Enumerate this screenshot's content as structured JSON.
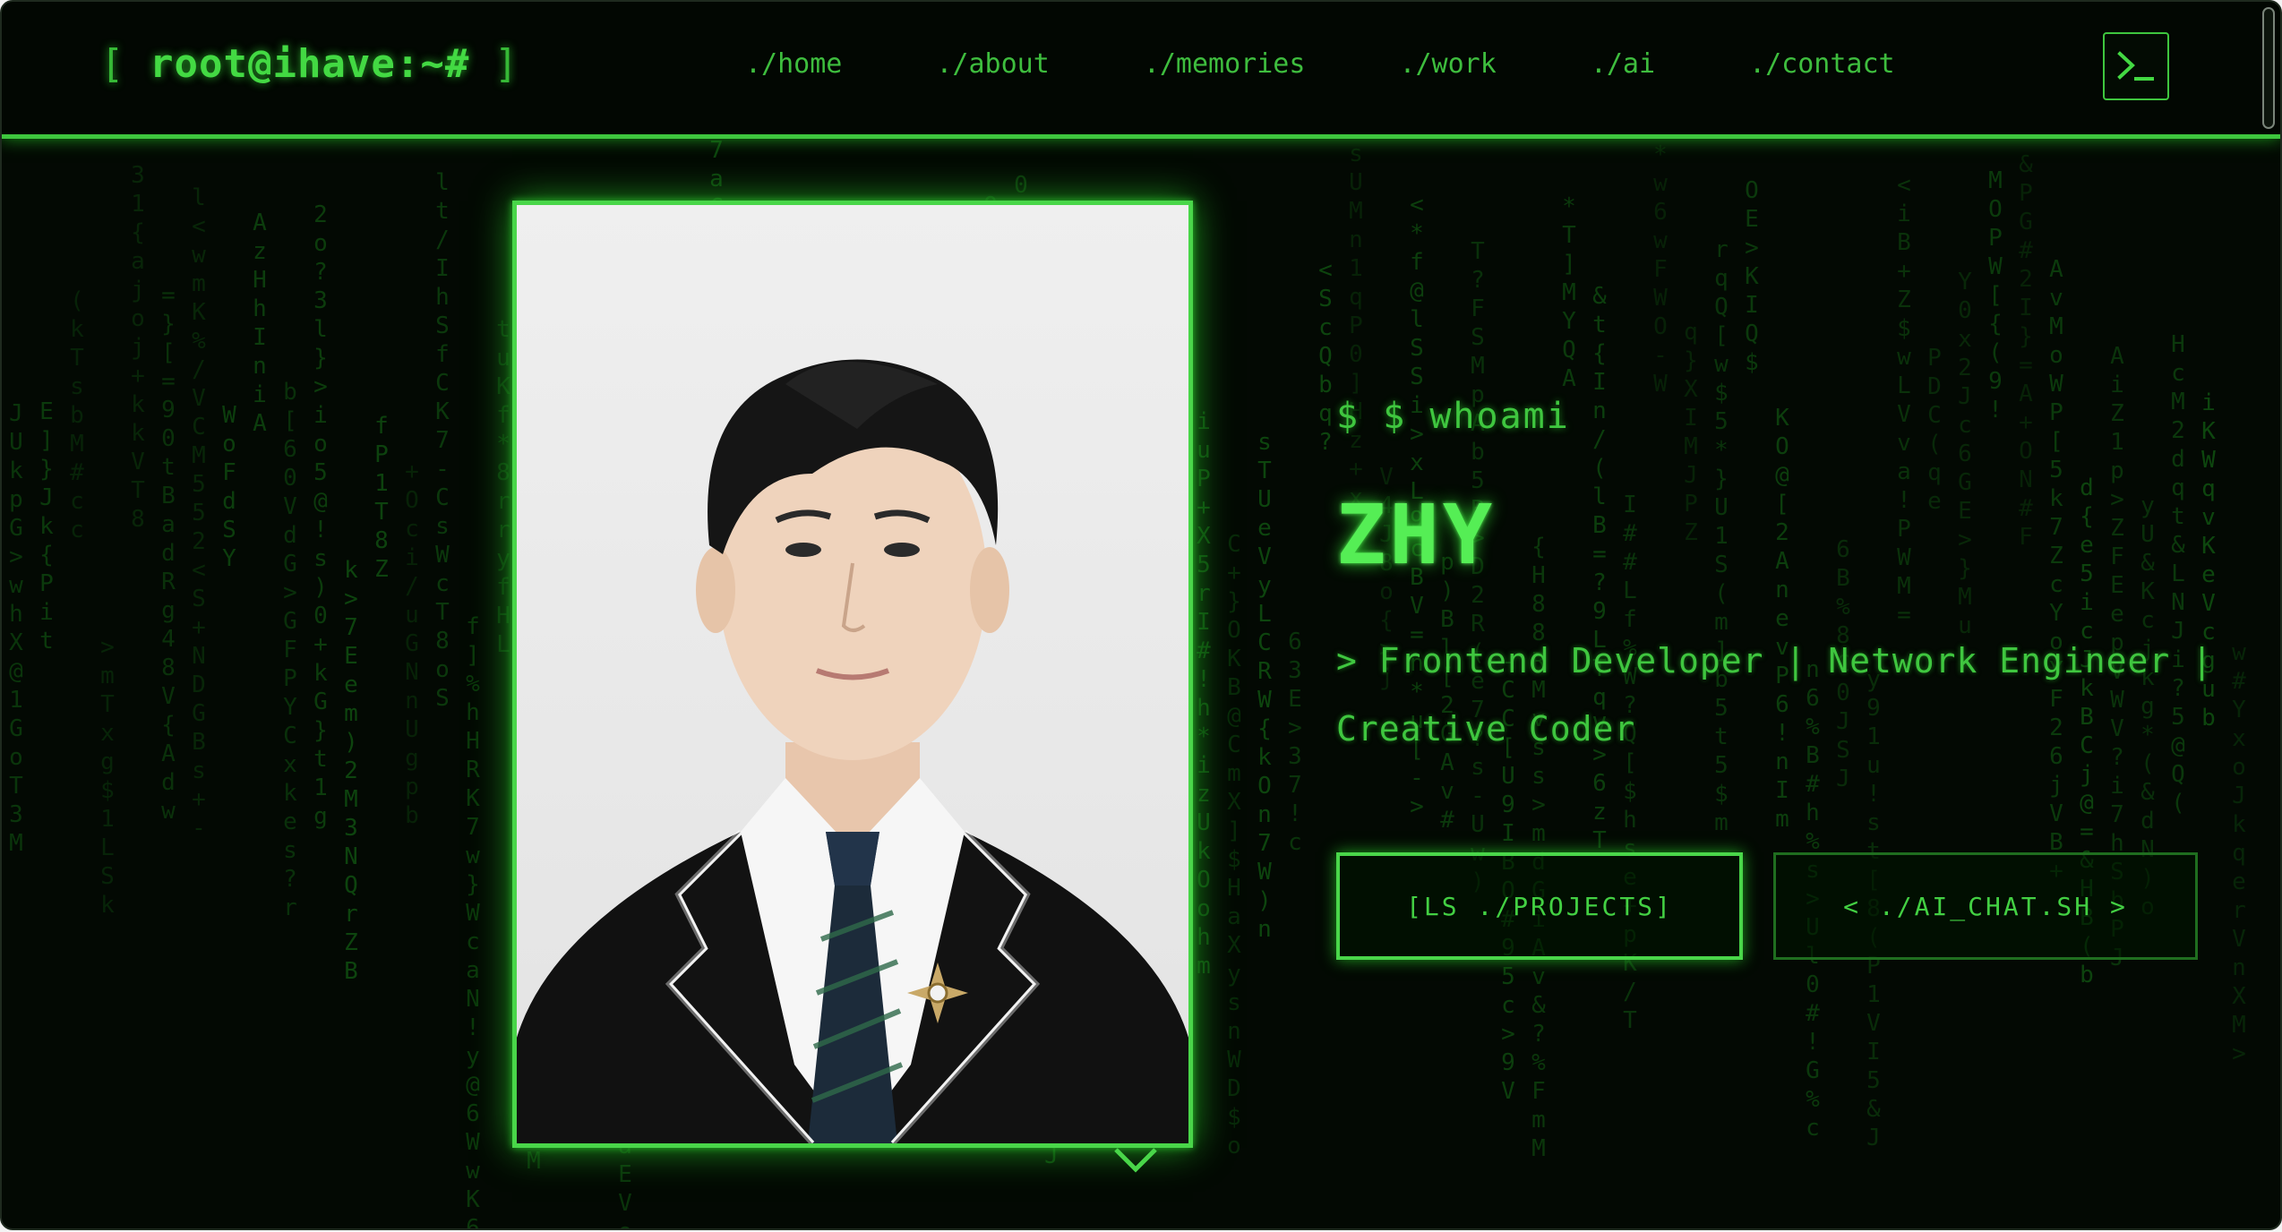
{
  "header": {
    "brand_open": "[",
    "brand": "root@ihave:~#",
    "brand_close": "]",
    "nav": [
      {
        "label": "./home"
      },
      {
        "label": "./about"
      },
      {
        "label": "./memories"
      },
      {
        "label": "./work"
      },
      {
        "label": "./ai"
      },
      {
        "label": "./contact"
      }
    ],
    "terminal_icon": "terminal-icon"
  },
  "hero": {
    "prompt": "$ $ whoami",
    "name": "ZHY",
    "tagline": "> Frontend Developer | Network Engineer | Creative Coder",
    "buttons": {
      "projects": "[LS ./PROJECTS]",
      "ai_chat": "< ./AI_CHAT.SH >"
    }
  },
  "colors": {
    "background": "#030903",
    "accent": "#3ec63e",
    "accent_bright": "#55ee55",
    "rain": "#0f4d10"
  }
}
